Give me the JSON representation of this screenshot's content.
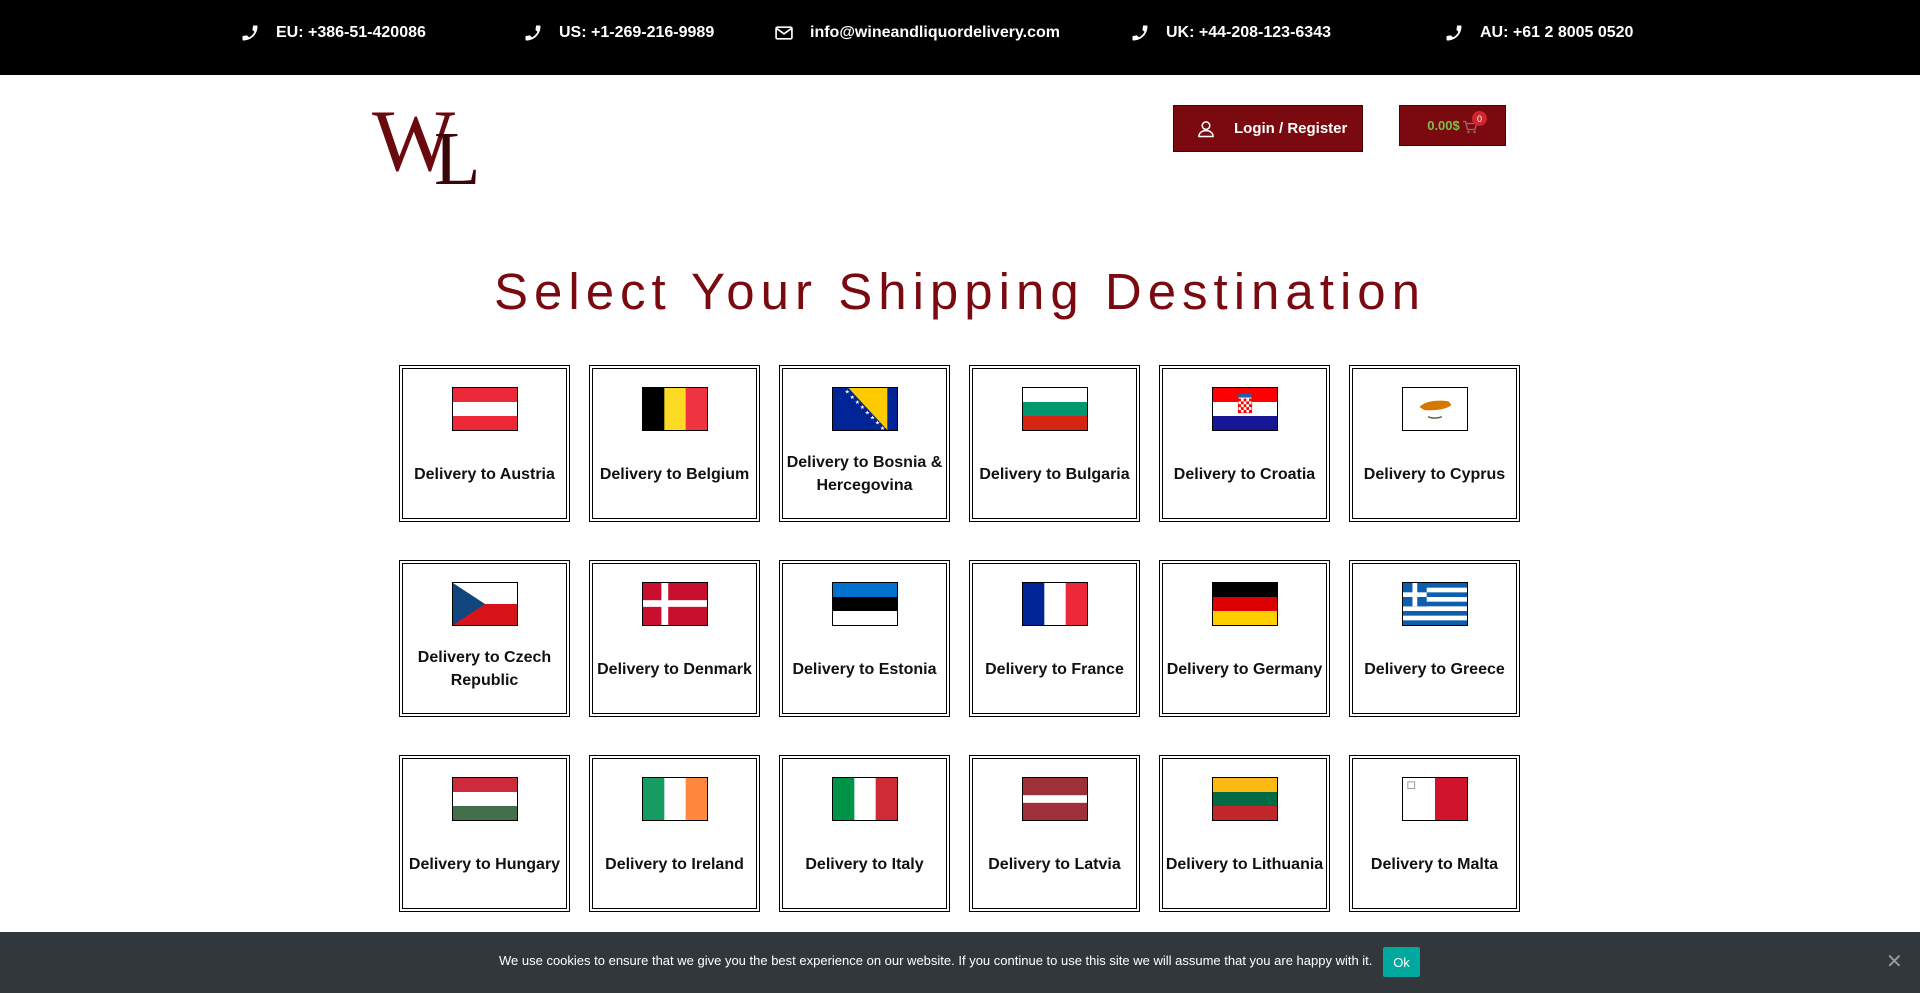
{
  "topbar": {
    "contacts": [
      {
        "icon": "phone-icon",
        "text": "EU: +386-51-420086"
      },
      {
        "icon": "phone-icon",
        "text": "US: +1-269-216-9989"
      },
      {
        "icon": "envelope-icon",
        "text": "info@wineandliquordelivery.com"
      },
      {
        "icon": "phone-icon",
        "text": "UK: +44-208-123-6343"
      },
      {
        "icon": "phone-icon",
        "text": "AU: +61 2 8005 0520"
      }
    ]
  },
  "header": {
    "logo_text": "WL",
    "login_label": "Login / Register",
    "cart_total": "0.00$",
    "cart_count": "0"
  },
  "main": {
    "title": "Select Your Shipping Destination",
    "countries": [
      {
        "label": "Delivery to Austria",
        "flag": "austria"
      },
      {
        "label": "Delivery to Belgium",
        "flag": "belgium"
      },
      {
        "label": "Delivery to Bosnia & Hercegovina",
        "flag": "bosnia"
      },
      {
        "label": "Delivery to Bulgaria",
        "flag": "bulgaria"
      },
      {
        "label": "Delivery to Croatia",
        "flag": "croatia"
      },
      {
        "label": "Delivery to Cyprus",
        "flag": "cyprus"
      },
      {
        "label": "Delivery to Czech Republic",
        "flag": "czech"
      },
      {
        "label": "Delivery to Denmark",
        "flag": "denmark"
      },
      {
        "label": "Delivery to Estonia",
        "flag": "estonia"
      },
      {
        "label": "Delivery to France",
        "flag": "france"
      },
      {
        "label": "Delivery to Germany",
        "flag": "germany"
      },
      {
        "label": "Delivery to Greece",
        "flag": "greece"
      },
      {
        "label": "Delivery to Hungary",
        "flag": "hungary"
      },
      {
        "label": "Delivery to Ireland",
        "flag": "ireland"
      },
      {
        "label": "Delivery to Italy",
        "flag": "italy"
      },
      {
        "label": "Delivery to Latvia",
        "flag": "latvia"
      },
      {
        "label": "Delivery to Lithuania",
        "flag": "lithuania"
      },
      {
        "label": "Delivery to Malta",
        "flag": "malta"
      }
    ]
  },
  "cookie": {
    "text": "We use cookies to ensure that we give you the best experience on our website. If you continue to use this site we will assume that you are happy with it.",
    "ok_label": "Ok",
    "close_label": "✕"
  },
  "colors": {
    "brand": "#7a0a10",
    "cart_total": "#7cc04b",
    "cookie_bg": "#32373c",
    "cookie_ok": "#00a99d"
  }
}
